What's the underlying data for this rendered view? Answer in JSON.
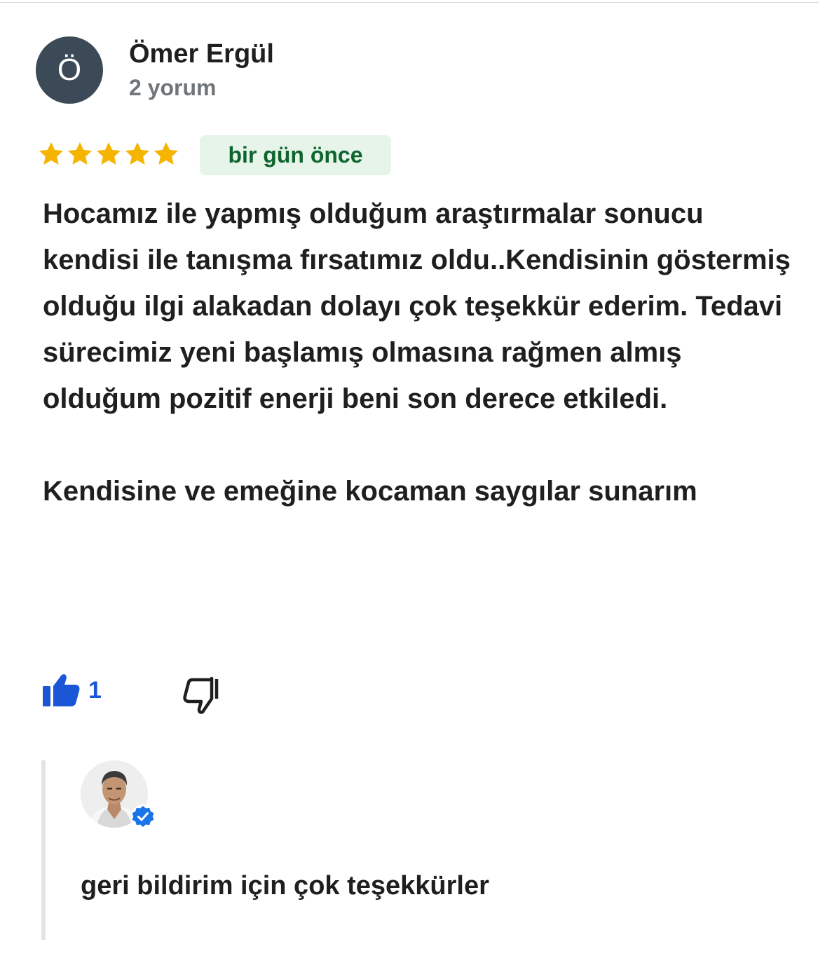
{
  "review": {
    "author": {
      "initial": "Ö",
      "name": "Ömer Ergül",
      "review_count": "2 yorum",
      "avatar_color": "#3c4a57"
    },
    "rating": {
      "stars": 5,
      "max": 5,
      "star_color": "#f5b400",
      "icon": "star-icon"
    },
    "time": "bir gün önce",
    "text": {
      "body": "Hocamız ile yapmış olduğum araştırmalar sonucu kendisi ile tanışma fırsatımız oldu..Kendisinin göstermiş olduğu ilgi alakadan dolayı çok teşekkür ederim. Tedavi sürecimiz yeni başlamış olmasına rağmen almış olduğum pozitif enerji beni son derece etkiledi.",
      "closing": "Kendisine ve emeğine kocaman saygılar sunarım"
    },
    "actions": {
      "like_count": "1",
      "like_icon": "thumbs-up-icon",
      "dislike_icon": "thumbs-down-icon",
      "like_color": "#1a56d6"
    }
  },
  "reply": {
    "owner_avatar_icon": "owner-photo",
    "verified_icon": "verified-check-icon",
    "verified_color": "#1a73e8",
    "text": "geri bildirim için çok teşekkürler"
  }
}
